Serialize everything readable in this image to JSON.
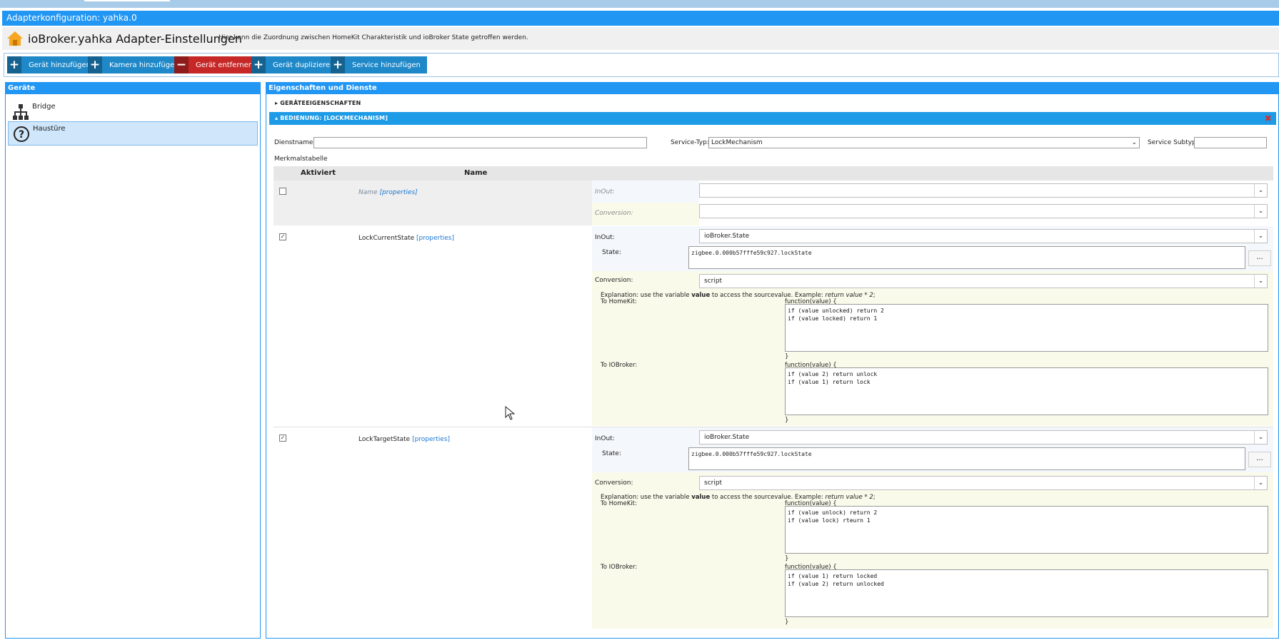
{
  "window": {
    "title": "Adapterkonfiguration: yahka.0"
  },
  "header": {
    "app_title": "ioBroker.yahka Adapter-Einstellungen",
    "description": "Hier kann die Zuordnung zwischen HomeKit Charakteristik und ioBroker State getroffen werden.",
    "icon": "home-icon"
  },
  "toolbar": {
    "add_device": "Gerät hinzufügen",
    "add_camera": "Kamera hinzufügen",
    "remove_device": "Gerät entfernen",
    "duplicate_device": "Gerät duplizieren",
    "add_service": "Service hinzufügen",
    "colors": {
      "blue": "#1e88c8",
      "red": "#c62828"
    }
  },
  "devices": {
    "title": "Geräte",
    "items": [
      {
        "label": "Bridge",
        "icon": "network-tree-icon"
      },
      {
        "label": "Haustüre",
        "icon": "question-circle-icon",
        "selected": true
      }
    ]
  },
  "properties": {
    "title": "Eigenschaften und Dienste",
    "section_device": "GERÄTEEIGENSCHAFTEN",
    "section_service": "BEDIENUNG: [LOCKMECHANISM]",
    "service_name_label": "Dienstname:",
    "service_name_value": "",
    "service_type_label": "Service-Typ:",
    "service_type_value": "LockMechanism",
    "service_subtype_label": "Service Subtyp:",
    "service_subtype_value": "",
    "table_label": "Merkmalstabelle",
    "col_activated": "Aktiviert",
    "col_name": "Name"
  },
  "labels": {
    "inout": "InOut:",
    "conversion": "Conversion:",
    "state": "State:",
    "properties_link": "[properties]",
    "explanation_prefix": "Explanation: use the variable ",
    "explanation_var": "value",
    "explanation_mid": " to access the sourcevalue. Example: ",
    "explanation_example": "return value * 2",
    "explanation_end": ";",
    "to_homekit": "To HomeKit:",
    "to_iobroker": "To IOBroker:",
    "fn_open": "function(value) {",
    "fn_close": "}",
    "more": "..."
  },
  "characteristics": [
    {
      "name": "Name",
      "enabled": false,
      "inout": "",
      "conversion": ""
    },
    {
      "name": "LockCurrentState",
      "enabled": true,
      "inout": "ioBroker.State",
      "state": "zigbee.0.000b57fffe59c927.lockState",
      "conversion": "script",
      "to_homekit": "if (value unlocked) return 2\nif (value locked) return 1",
      "to_iobroker": "if (value 2) return unlock\nif (value 1) return lock"
    },
    {
      "name": "LockTargetState",
      "enabled": true,
      "inout": "ioBroker.State",
      "state": "zigbee.0.000b57fffe59c927.lockState",
      "conversion": "script",
      "to_homekit": "if (value unlock) return 2\nif (value lock) rteurn 1",
      "to_iobroker": "if (value 1) return locked\nif (value 2) return unlocked"
    }
  ],
  "theme": {
    "accent": "#2196f3",
    "close_red": "#d32f2f",
    "selected_bg": "#cfe6fb"
  }
}
